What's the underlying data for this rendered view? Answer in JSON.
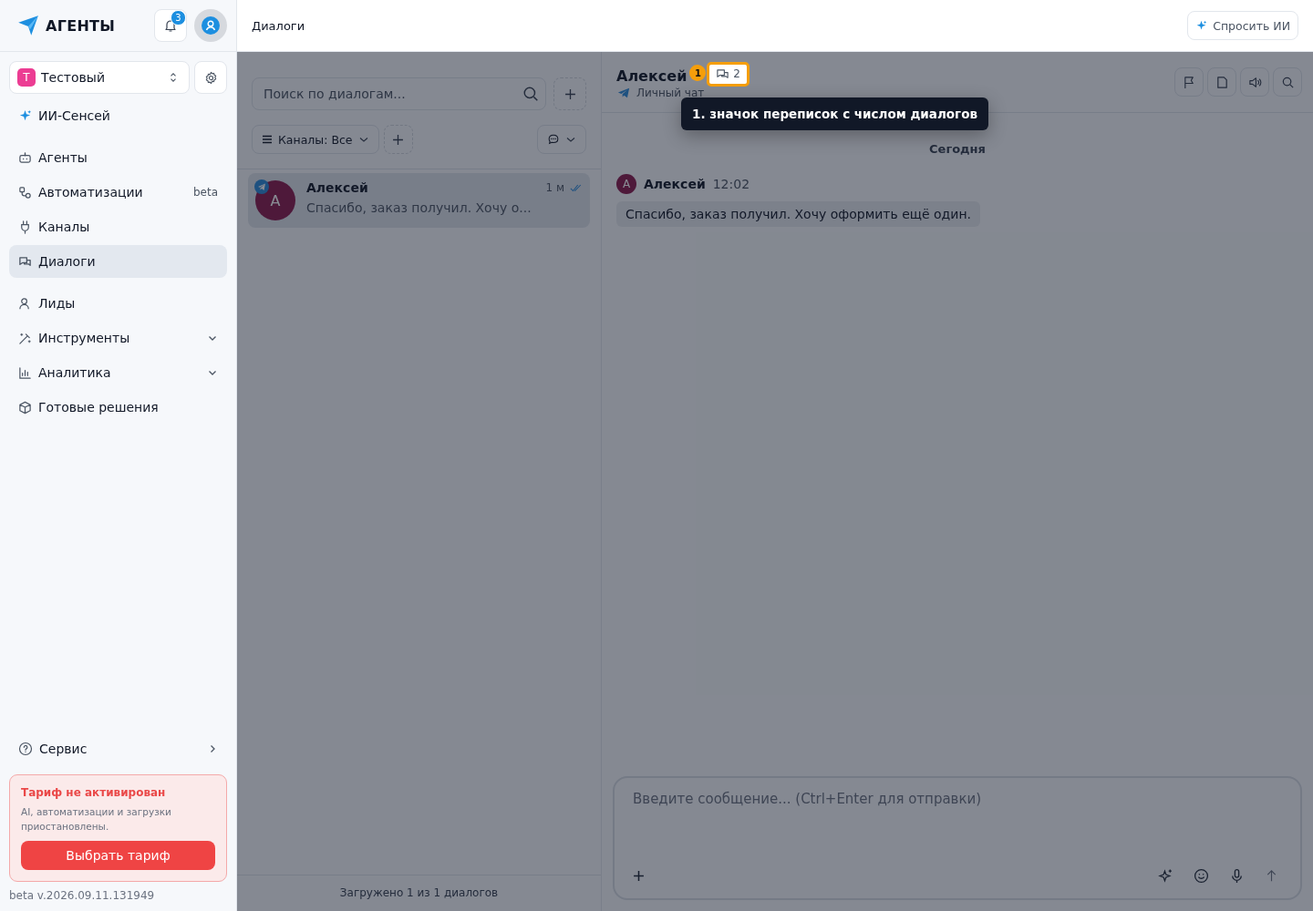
{
  "brand": {
    "name": "АГЕНТЫ"
  },
  "notifications": {
    "count": "3"
  },
  "workspace": {
    "initial": "Т",
    "name": "Тестовый"
  },
  "sidebar": {
    "groups": [
      [
        {
          "label": "ИИ-Сенсей",
          "kind": "link",
          "selected": false
        }
      ],
      [
        {
          "label": "Агенты",
          "kind": "link",
          "selected": false
        },
        {
          "label": "Автоматизации",
          "kind": "link",
          "badge": "beta",
          "selected": false
        },
        {
          "label": "Каналы",
          "kind": "link",
          "selected": false
        },
        {
          "label": "Диалоги",
          "kind": "link",
          "selected": true
        }
      ],
      [
        {
          "label": "Лиды",
          "kind": "link",
          "selected": false
        },
        {
          "label": "Инструменты",
          "kind": "group",
          "selected": false
        },
        {
          "label": "Аналитика",
          "kind": "group",
          "selected": false
        },
        {
          "label": "Готовые решения",
          "kind": "link",
          "selected": false
        }
      ]
    ]
  },
  "service": {
    "label": "Сервис"
  },
  "plan_notice": {
    "title": "Тариф не активирован",
    "text": "AI, автоматизации и загрузки приостановлены.",
    "button": "Выбрать тариф"
  },
  "version": "beta v.2026.09.11.131949",
  "header": {
    "title": "Диалоги",
    "ask_ai": "Спросить ИИ"
  },
  "dialogs": {
    "search": {
      "placeholder": "Поиск по диалогам..."
    },
    "channel_filter": "Каналы: Все",
    "items": [
      {
        "name": "Алексей",
        "initial": "А",
        "preview": "Спасибо, заказ получил. Хочу о...",
        "time": "1 м",
        "read": true,
        "selected": true
      }
    ],
    "footer": "Загружено 1 из 1 диалогов"
  },
  "chat": {
    "name": "Алексей",
    "chat_count": "2",
    "subtitle": "Личный чат",
    "date": "Сегодня",
    "messages": [
      {
        "author": "Алексей",
        "initial": "А",
        "time": "12:02",
        "text": "Спасибо, заказ получил. Хочу оформить ещё один."
      }
    ],
    "composer": {
      "placeholder": "Введите сообщение... (Ctrl+Enter для отправки)"
    }
  },
  "tour": {
    "step": "1",
    "text": "1. значок переписок с числом диалогов"
  }
}
